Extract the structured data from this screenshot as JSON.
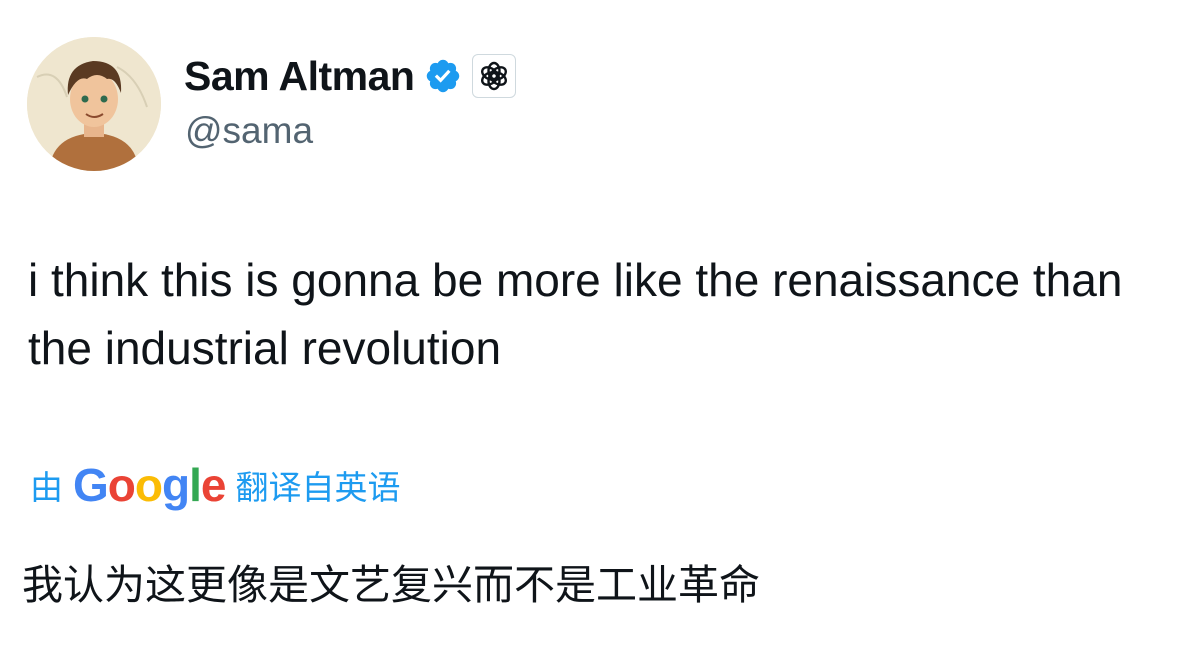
{
  "author": {
    "display_name": "Sam Altman",
    "handle": "@sama",
    "verified_icon": "verified-badge-icon",
    "affiliate_icon": "openai-logo-icon",
    "accent_color": "#1d9bf0"
  },
  "tweet": {
    "text": "i think this is gonna be more like the renaissance than the industrial revolution"
  },
  "translation": {
    "prefix": "由",
    "provider": [
      "G",
      "o",
      "o",
      "g",
      "l",
      "e"
    ],
    "provider_colors": [
      "#4285F4",
      "#EA4335",
      "#FBBC05",
      "#4285F4",
      "#34A853",
      "#EA4335"
    ],
    "suffix": "翻译自英语",
    "text": "我认为这更像是文艺复兴而不是工业革命"
  }
}
